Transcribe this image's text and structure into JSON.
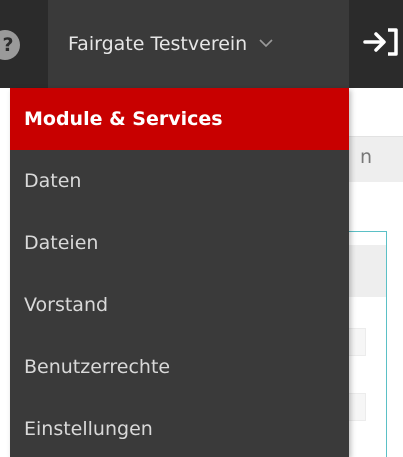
{
  "topbar": {
    "help_icon_glyph": "?",
    "org_name": "Fairgate Testverein",
    "org_chevron_icon": "chevron-down-icon",
    "logout_icon": "sign-out-icon"
  },
  "background": {
    "tab_fragment": "n"
  },
  "menu": {
    "items": [
      {
        "label": "Module & Services",
        "active": true
      },
      {
        "label": "Daten",
        "active": false
      },
      {
        "label": "Dateien",
        "active": false
      },
      {
        "label": "Vorstand",
        "active": false
      },
      {
        "label": "Benutzerrechte",
        "active": false
      },
      {
        "label": "Einstellungen",
        "active": false
      }
    ]
  },
  "colors": {
    "topbar_bg": "#2b2b2b",
    "menu_bg": "#3a3a3a",
    "active_item_bg": "#c80000",
    "accent_border": "#5bc0c6"
  }
}
